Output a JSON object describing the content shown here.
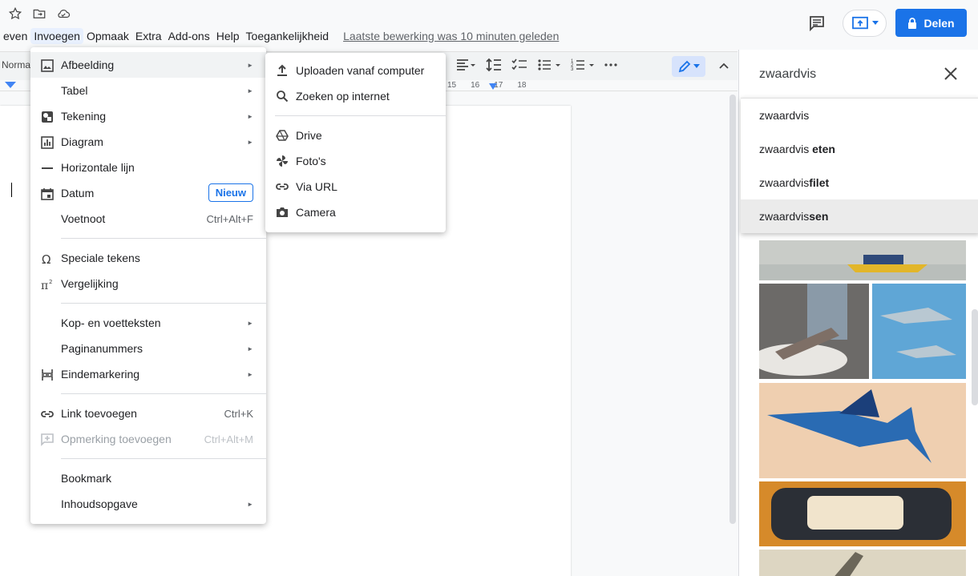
{
  "menubar": {
    "items": [
      "even",
      "Invoegen",
      "Opmaak",
      "Extra",
      "Add-ons",
      "Help",
      "Toegankelijkheid"
    ],
    "last_edit": "Laatste bewerking was 10 minuten geleden"
  },
  "header": {
    "share_label": "Delen"
  },
  "toolbar": {
    "style_label": "Norma"
  },
  "ruler": {
    "marks": [
      "15",
      "16",
      "17",
      "18"
    ]
  },
  "insert_menu": {
    "items": [
      {
        "label": "Afbeelding",
        "icon": "image-icon",
        "submenu": true
      },
      {
        "label": "Tabel",
        "submenu": true
      },
      {
        "label": "Tekening",
        "icon": "drawing-icon",
        "submenu": true
      },
      {
        "label": "Diagram",
        "icon": "chart-icon",
        "submenu": true
      },
      {
        "label": "Horizontale lijn",
        "icon": "horizontal-line-icon"
      },
      {
        "label": "Datum",
        "icon": "calendar-icon",
        "badge": "Nieuw"
      },
      {
        "label": "Voetnoot",
        "shortcut": "Ctrl+Alt+F"
      },
      {
        "label": "Speciale tekens",
        "icon": "omega-icon"
      },
      {
        "label": "Vergelijking",
        "icon": "pi-icon"
      },
      {
        "label": "Kop- en voetteksten",
        "submenu": true
      },
      {
        "label": "Paginanummers",
        "submenu": true
      },
      {
        "label": "Eindemarkering",
        "icon": "page-break-icon",
        "submenu": true
      },
      {
        "label": "Link toevoegen",
        "icon": "link-icon",
        "shortcut": "Ctrl+K"
      },
      {
        "label": "Opmerking toevoegen",
        "icon": "comment-add-icon",
        "shortcut": "Ctrl+Alt+M"
      },
      {
        "label": "Bookmark"
      },
      {
        "label": "Inhoudsopgave",
        "submenu": true
      }
    ]
  },
  "image_submenu": {
    "items": [
      {
        "label": "Uploaden vanaf computer",
        "icon": "upload-icon"
      },
      {
        "label": "Zoeken op internet",
        "icon": "search-icon"
      },
      {
        "label": "Drive",
        "icon": "drive-icon"
      },
      {
        "label": "Foto's",
        "icon": "photos-icon"
      },
      {
        "label": "Via URL",
        "icon": "link-icon"
      },
      {
        "label": "Camera",
        "icon": "camera-icon"
      }
    ]
  },
  "search_panel": {
    "query": "zwaardvis",
    "suggestions": [
      {
        "base": "zwaardvis",
        "bold": ""
      },
      {
        "base": "zwaardvis ",
        "bold": "eten"
      },
      {
        "base": "zwaardvis",
        "bold": "filet"
      },
      {
        "base": "zwaardvis",
        "bold": "sen"
      }
    ]
  },
  "colors": {
    "accent": "#1a73e8",
    "menu_hover": "#f1f3f4"
  }
}
